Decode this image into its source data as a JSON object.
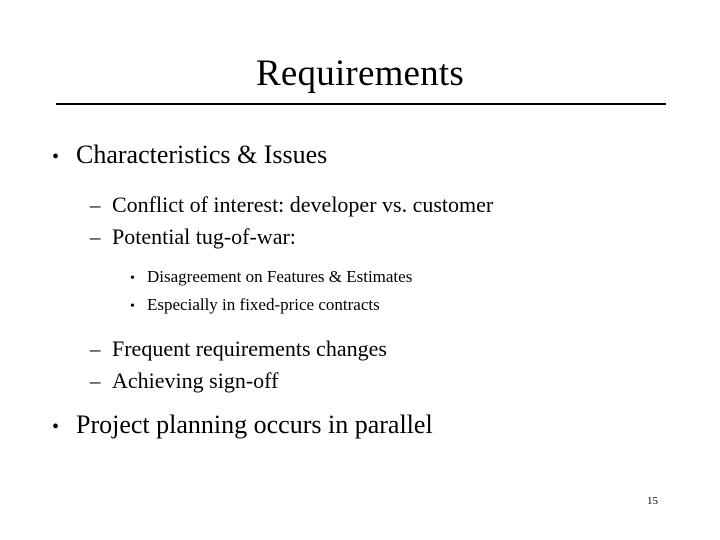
{
  "slide": {
    "title": "Requirements",
    "page_number": "15",
    "text_color": "#000000",
    "background_color": "#ffffff",
    "markers": {
      "level1": "•",
      "level2": "–",
      "level3": "•"
    },
    "outline": [
      {
        "level": 1,
        "marker": "•",
        "text": "Characteristics & Issues"
      },
      {
        "level": 2,
        "marker": "–",
        "text": "Conflict of interest: developer vs. customer"
      },
      {
        "level": 2,
        "marker": "–",
        "text": "Potential tug-of-war:"
      },
      {
        "level": 3,
        "marker": "•",
        "text": "Disagreement on Features & Estimates"
      },
      {
        "level": 3,
        "marker": "•",
        "text": "Especially in fixed-price contracts"
      },
      {
        "level": 2,
        "marker": "–",
        "text": "Frequent requirements changes"
      },
      {
        "level": 2,
        "marker": "–",
        "text": "Achieving sign-off"
      },
      {
        "level": 1,
        "marker": "•",
        "text": "Project planning occurs in parallel"
      }
    ]
  }
}
